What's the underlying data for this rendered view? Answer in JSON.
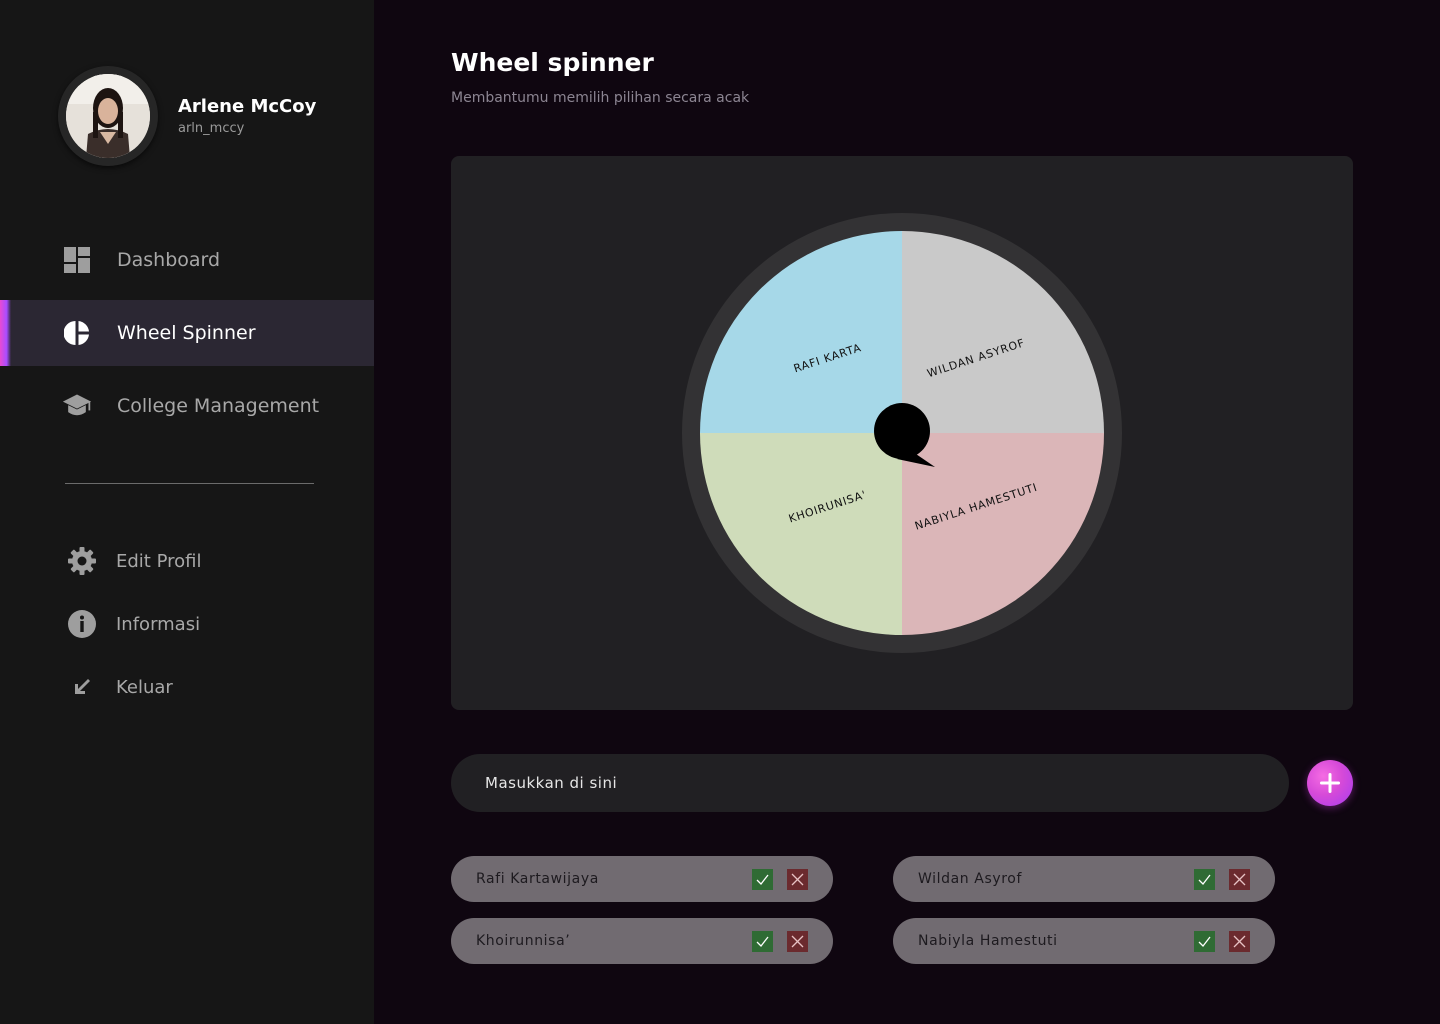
{
  "profile": {
    "name": "Arlene McCoy",
    "handle": "arln_mccy"
  },
  "nav": {
    "items": [
      {
        "label": "Dashboard",
        "icon": "dashboard-icon",
        "active": false
      },
      {
        "label": "Wheel Spinner",
        "icon": "pie-chart-icon",
        "active": true
      },
      {
        "label": "College Management",
        "icon": "graduation-cap-icon",
        "active": false
      }
    ],
    "secondary": [
      {
        "label": "Edit Profil",
        "icon": "gear-icon"
      },
      {
        "label": "Informasi",
        "icon": "info-icon"
      },
      {
        "label": "Keluar",
        "icon": "arrow-down-left-icon"
      }
    ]
  },
  "page": {
    "title": "Wheel spinner",
    "subtitle": "Membantumu memilih pilihan secara acak"
  },
  "wheel": {
    "segments": [
      {
        "label": "RAFI KARTA",
        "color": "#a6d8e8"
      },
      {
        "label": "WILDAN ASYROF",
        "color": "#c9c9c9"
      },
      {
        "label": "NABIYLA HAMESTUTI",
        "color": "#dbb6b8"
      },
      {
        "label": "KHOIRUNISA'",
        "color": "#cfdcba"
      }
    ],
    "rim_color": "#333234",
    "pointer_color": "#000000"
  },
  "entry": {
    "placeholder": "Masukkan di sini"
  },
  "entries": [
    {
      "label": "Rafi Kartawijaya"
    },
    {
      "label": "Wildan Asyrof"
    },
    {
      "label": "Khoirunnisa’"
    },
    {
      "label": "Nabiyla Hamestuti"
    }
  ],
  "colors": {
    "accent": "#d64ad8",
    "confirm": "#2f6b34",
    "remove": "#6b2a2e"
  }
}
